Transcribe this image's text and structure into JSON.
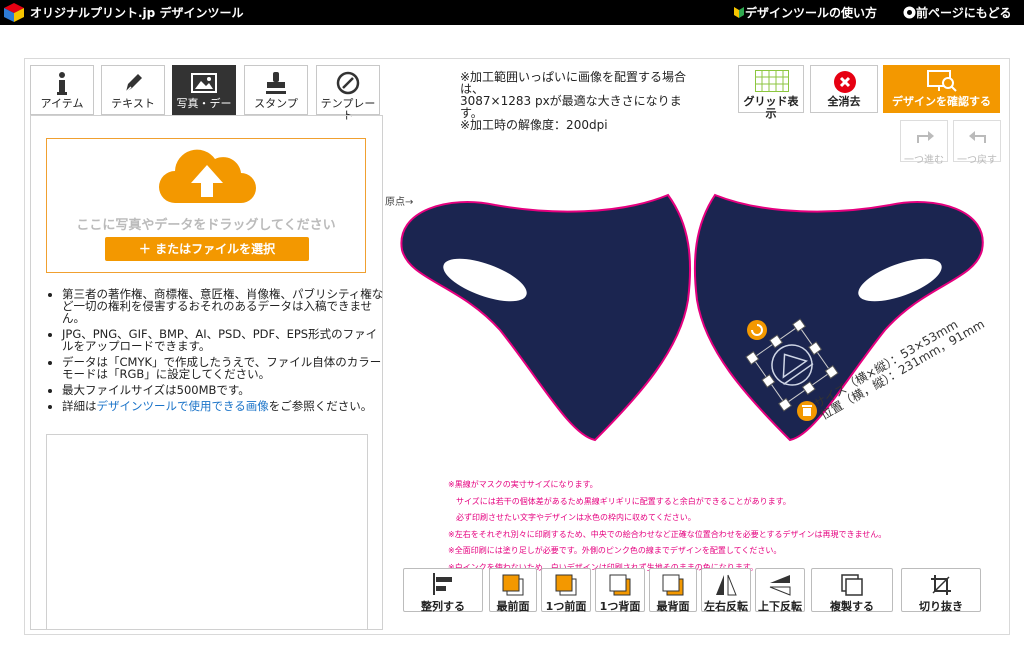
{
  "header": {
    "brand": "オリジナルプリント.jp デザインツール",
    "help_link": "デザインツールの使い方",
    "back_link": "前ページにもどる"
  },
  "tabs": [
    {
      "label": "アイテム",
      "icon": "info-icon",
      "active": false
    },
    {
      "label": "テキスト",
      "icon": "pen-icon",
      "active": false
    },
    {
      "label": "写真・デー",
      "icon": "image-icon",
      "active": true
    },
    {
      "label": "スタンプ",
      "icon": "stamp-icon",
      "active": false
    },
    {
      "label": "テンプレート",
      "icon": "template-icon",
      "active": false
    }
  ],
  "upload": {
    "drop_text": "ここに写真やデータをドラッグしてください",
    "select_button": "＋ またはファイルを選択"
  },
  "notes": {
    "item1": "第三者の著作権、商標権、意匠権、肖像権、パブリシティ権など一切の権利を侵害するおそれのあるデータは入稿できません。",
    "item2": "JPG、PNG、GIF、BMP、AI、PSD、PDF、EPS形式のファイルをアップロードできます。",
    "item3": "データは「CMYK」で作成したうえで、ファイル自体のカラーモードは「RGB」に設定してください。",
    "item4": "最大ファイルサイズは500MBです。",
    "item5_pre": "詳細は",
    "item5_link": "デザインツールで使用できる画像",
    "item5_post": "をご参照ください。"
  },
  "info": {
    "line1": "※加工範囲いっぱいに画像を配置する場合は、",
    "line2": "3087×1283 pxが最適な大きさになります。",
    "line3": "※加工時の解像度：200dpi"
  },
  "toolbar": {
    "grid": "グリッド表示",
    "clear": "全消去",
    "confirm": "デザインを確認する",
    "redo": "一つ進む",
    "undo": "一つ戻す"
  },
  "canvas": {
    "origin": "原点→",
    "size_label": "サイズ（横×縦）：53×53mm",
    "position_label": "位置（横，縦）：231mm，91mm",
    "mask_color": "#1b2550",
    "outline_color": "#e5007f"
  },
  "print_notes": [
    "※黒線がマスクの実寸サイズになります。",
    "　サイズには若干の個体差があるため黒線ギリギリに配置すると余白ができることがあります。",
    "　必ず印刷させたい文字やデザインは水色の枠内に収めてください。",
    "※左右をそれぞれ別々に印刷するため、中央での絵合わせなど正確な位置合わせを必要とするデザインは再現できません。",
    "※全面印刷には塗り足しが必要です。外側のピンク色の線までデザインを配置してください。",
    "※白インクを使わないため、白いデザインは印刷されず生地そのままの色になります。"
  ],
  "bottom_buttons": {
    "align": "整列する",
    "front": "最前面",
    "forward": "1つ前面",
    "backward": "1つ背面",
    "back": "最背面",
    "flip_h": "左右反転",
    "flip_v": "上下反転",
    "duplicate": "複製する",
    "crop": "切り抜き"
  },
  "colors": {
    "accent": "#f39800",
    "danger": "#e60012",
    "grid": "#8cc63f"
  }
}
